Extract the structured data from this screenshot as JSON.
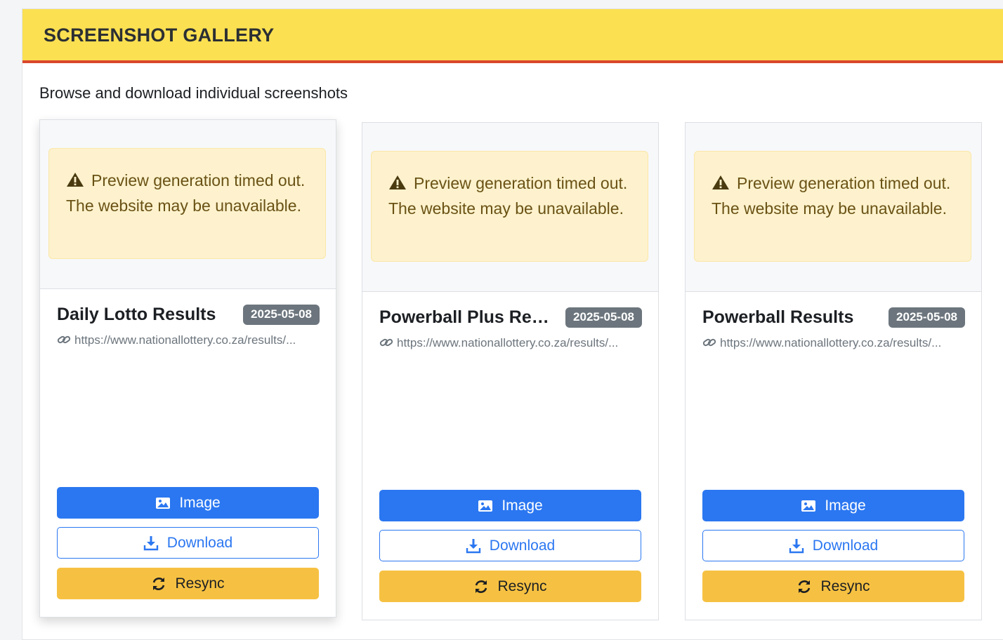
{
  "header": {
    "title": "SCREENSHOT GALLERY"
  },
  "subtitle": "Browse and download individual screenshots",
  "colors": {
    "header_bg": "#fbe052",
    "header_border": "#d9472b",
    "primary": "#2b77f1",
    "warning": "#f6c142",
    "alert_bg": "#fdf2cd",
    "badge_bg": "#6c757d"
  },
  "cards": [
    {
      "title": "Daily Lotto Results",
      "date": "2025-05-08",
      "url": "https://www.nationallottery.co.za/results/...",
      "alert": "Preview generation timed out. The website may be unavailable.",
      "buttons": {
        "image": "Image",
        "download": "Download",
        "resync": "Resync"
      }
    },
    {
      "title": "Powerball Plus Res...",
      "date": "2025-05-08",
      "url": "https://www.nationallottery.co.za/results/...",
      "alert": "Preview generation timed out. The website may be unavailable.",
      "buttons": {
        "image": "Image",
        "download": "Download",
        "resync": "Resync"
      }
    },
    {
      "title": "Powerball Results",
      "date": "2025-05-08",
      "url": "https://www.nationallottery.co.za/results/...",
      "alert": "Preview generation timed out. The website may be unavailable.",
      "buttons": {
        "image": "Image",
        "download": "Download",
        "resync": "Resync"
      }
    }
  ],
  "icons": {
    "alert": "warning-triangle-icon",
    "url": "link-icon",
    "image": "image-icon",
    "download": "download-icon",
    "resync": "sync-icon"
  }
}
